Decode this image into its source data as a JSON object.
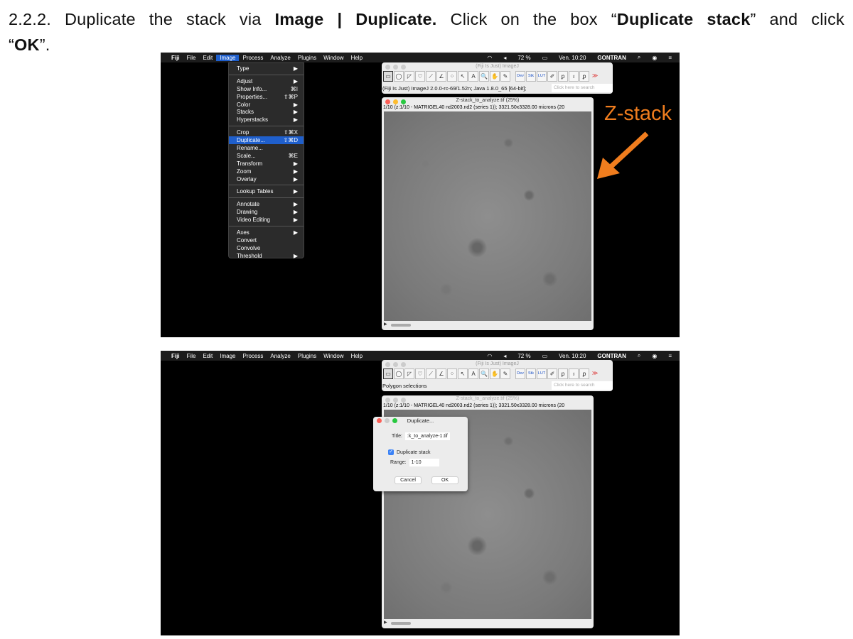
{
  "instruction": {
    "line1_a": "2.2.2. Duplicate the stack via ",
    "line1_b": "Image | Duplicate.",
    "line1_c": " Click on the box “",
    "line1_d": "Duplicate stack",
    "line1_e": "” and click",
    "line2_a": "“",
    "line2_b": "OK",
    "line2_c": "”."
  },
  "menubar": {
    "items": [
      "Fiji",
      "File",
      "Edit",
      "Image",
      "Process",
      "Analyze",
      "Plugins",
      "Window",
      "Help"
    ],
    "battery": "72 %",
    "clock": "Ven. 10:20",
    "user": "GONTRAN"
  },
  "image_menu": [
    {
      "label": "Type",
      "sc": "▶"
    },
    {
      "sep": true
    },
    {
      "label": "Adjust",
      "sc": "▶"
    },
    {
      "label": "Show Info...",
      "sc": "⌘I"
    },
    {
      "label": "Properties...",
      "sc": "⇧⌘P"
    },
    {
      "label": "Color",
      "sc": "▶"
    },
    {
      "label": "Stacks",
      "sc": "▶"
    },
    {
      "label": "Hyperstacks",
      "sc": "▶"
    },
    {
      "sep": true
    },
    {
      "label": "Crop",
      "sc": "⇧⌘X"
    },
    {
      "label": "Duplicate...",
      "sc": "⇧⌘D",
      "hl": true
    },
    {
      "label": "Rename...",
      "sc": ""
    },
    {
      "label": "Scale...",
      "sc": "⌘E"
    },
    {
      "label": "Transform",
      "sc": "▶"
    },
    {
      "label": "Zoom",
      "sc": "▶"
    },
    {
      "label": "Overlay",
      "sc": "▶"
    },
    {
      "sep": true
    },
    {
      "label": "Lookup Tables",
      "sc": "▶"
    },
    {
      "sep": true
    },
    {
      "label": "Annotate",
      "sc": "▶"
    },
    {
      "label": "Drawing",
      "sc": "▶"
    },
    {
      "label": "Video Editing",
      "sc": "▶"
    },
    {
      "sep": true
    },
    {
      "label": "Axes",
      "sc": "▶"
    },
    {
      "label": "Convert",
      "sc": ""
    },
    {
      "label": "Convolve",
      "sc": ""
    },
    {
      "label": "Threshold",
      "sc": "▶"
    }
  ],
  "imagej": {
    "title": "(Fiji Is Just) ImageJ",
    "tools": [
      "▭",
      "◯",
      "◸",
      "♡",
      "⟋",
      "∠",
      "⁘",
      "↖",
      "A",
      "🔍",
      "✋",
      "✎",
      "Dev",
      "Stk",
      "LUT",
      "✐",
      "ꝑ",
      "♁",
      "ꝑ",
      "≫"
    ],
    "status1": "(Fiji Is Just) ImageJ 2.0.0-rc-69/1.52n; Java 1.8.0_65 [64-bit];",
    "status2": "Polygon selections",
    "search": "Click here to search"
  },
  "image_window": {
    "title": "Z-stack_to_analyze.tif (25%)",
    "info": "1/10 (z:1/10 - MATRIGEL40 nd2003.nd2 (series 1)); 3321.50x3328.00 microns (20"
  },
  "annotation": "Z-stack",
  "dialog": {
    "title": "Duplicate...",
    "title_label": "Title:",
    "title_value": ":k_to_analyze-1.tif",
    "checkbox_label": "Duplicate stack",
    "checked": true,
    "range_label": "Range:",
    "range_value": "1-10",
    "cancel": "Cancel",
    "ok": "OK"
  }
}
